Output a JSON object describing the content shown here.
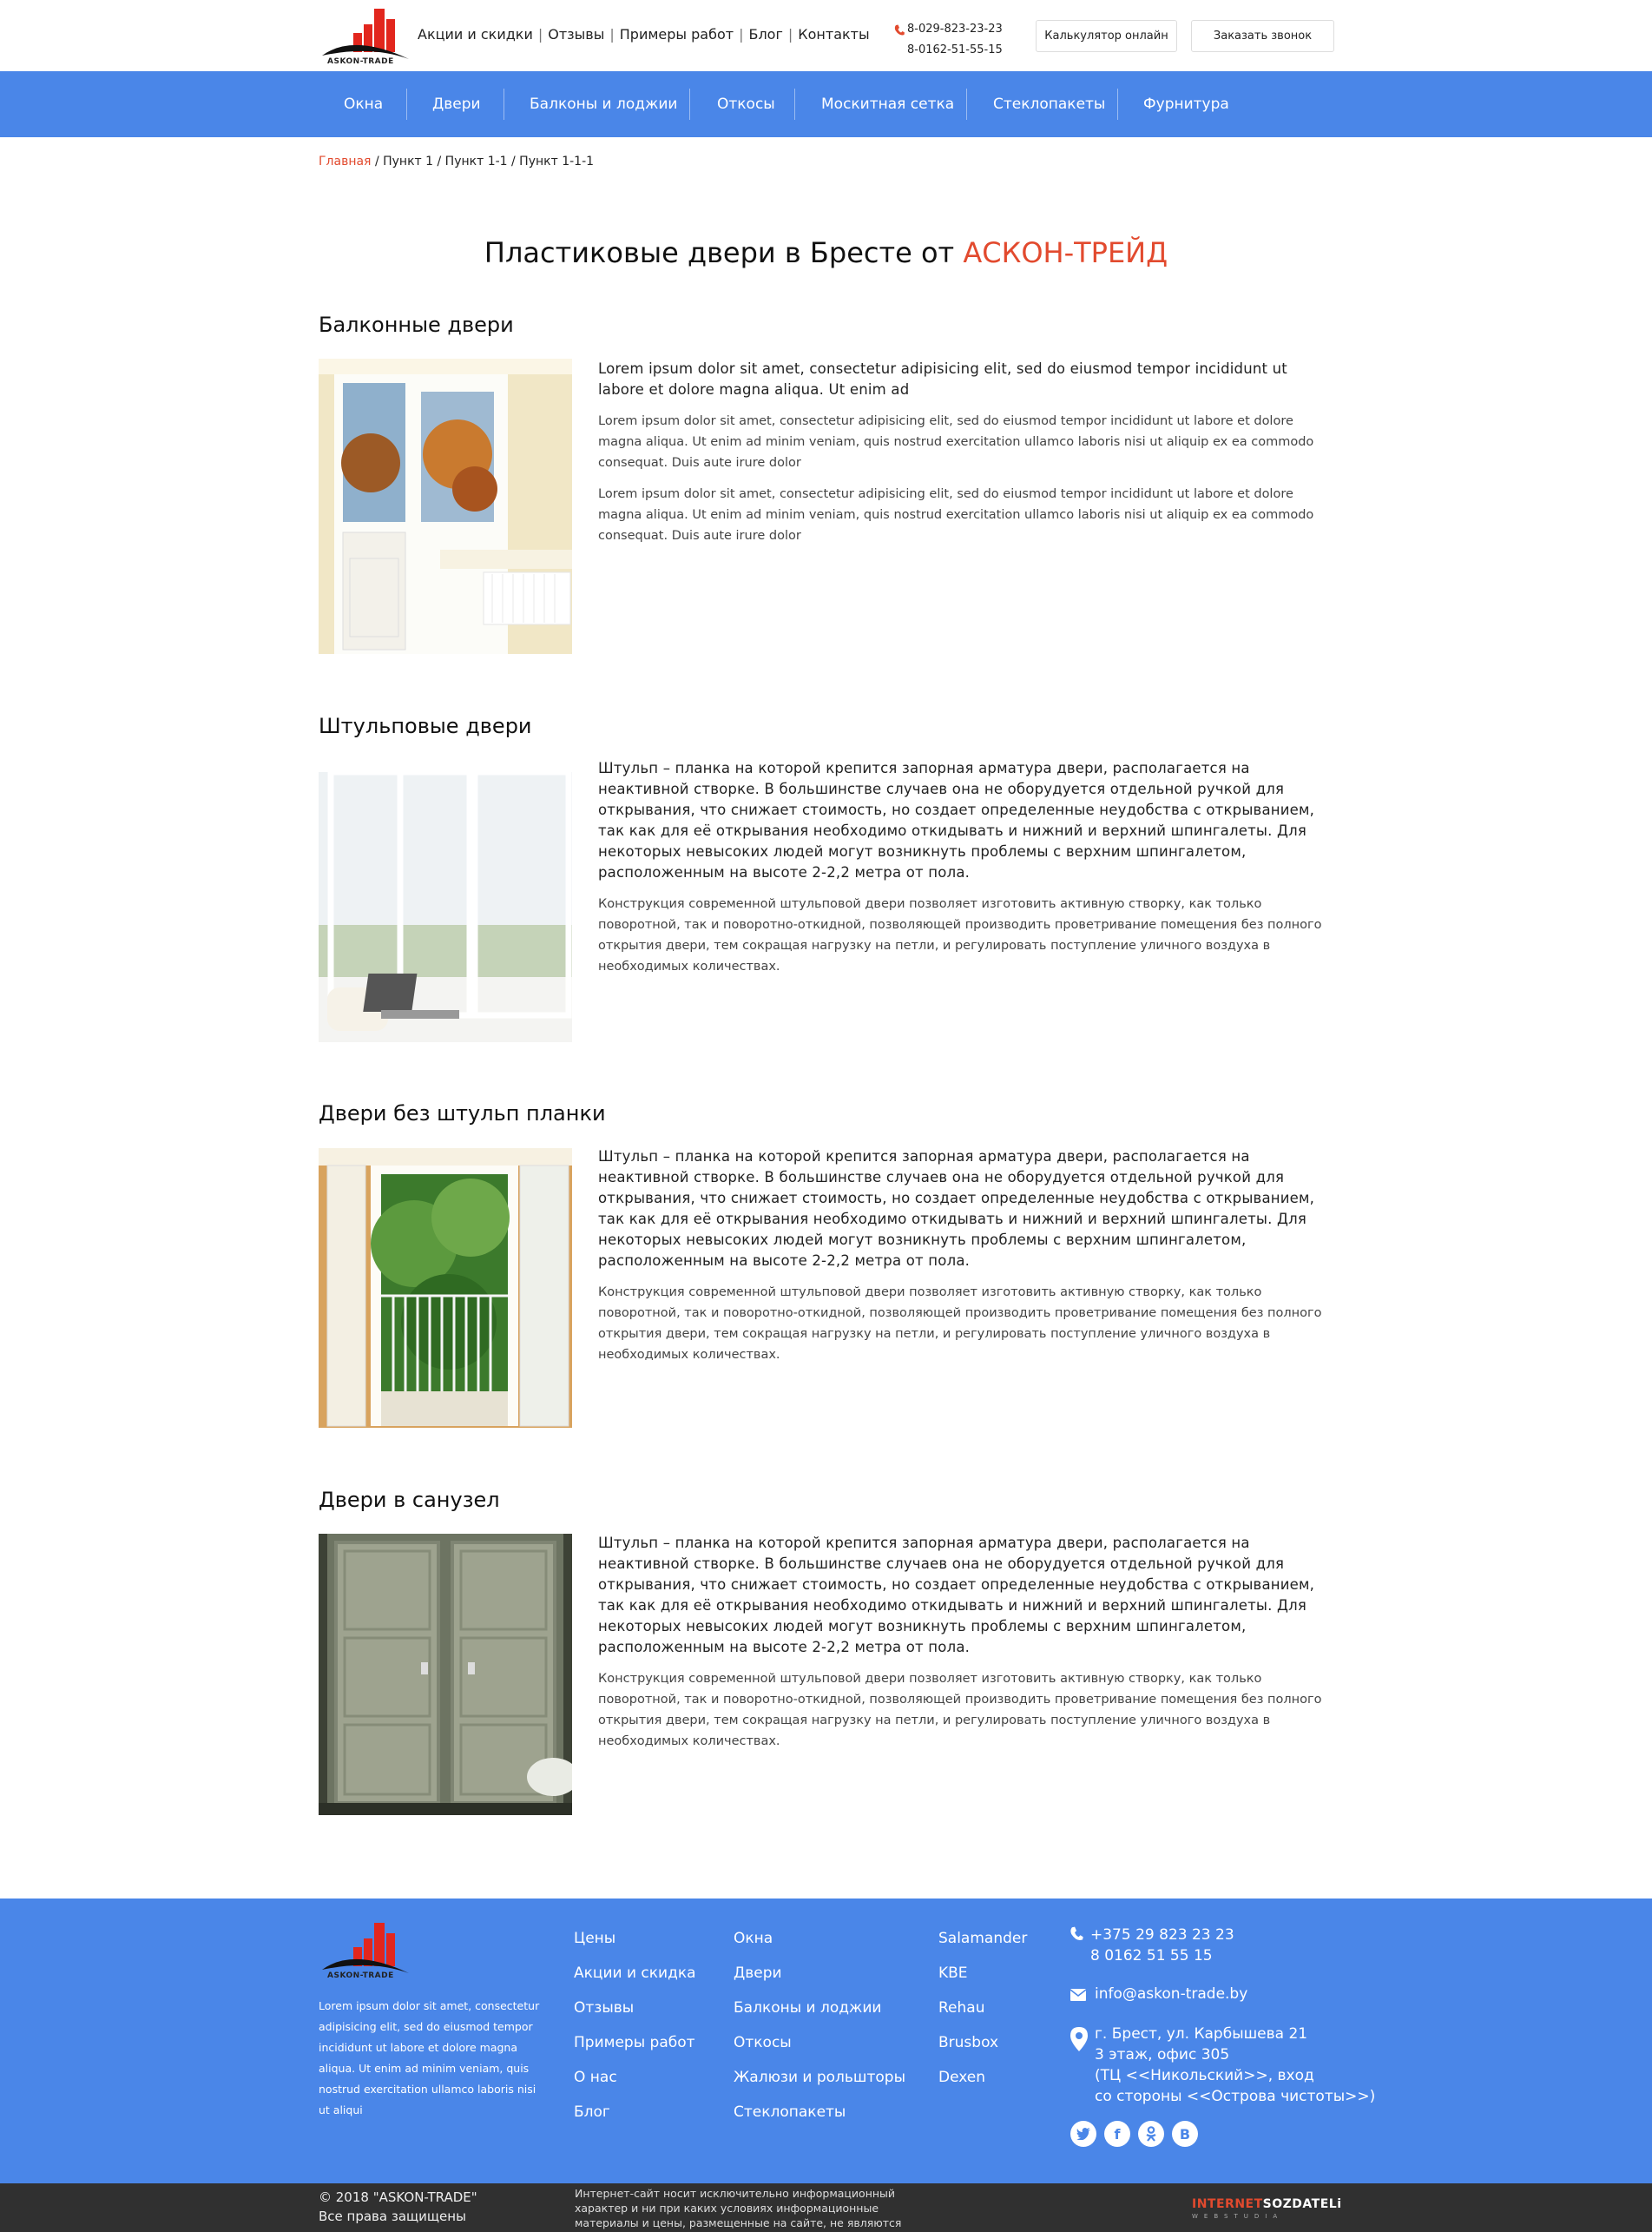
{
  "header": {
    "logo_text": "ASKON-TRADE",
    "menu": [
      "Акции и скидки",
      "Отзывы",
      "Примеры работ",
      "Блог",
      "Контакты"
    ],
    "phones": [
      "8-029-823-23-23",
      "8-0162-51-55-15"
    ],
    "calc_button": "Калькулятор онлайн",
    "call_button": "Заказать звонок"
  },
  "nav": [
    "Окна",
    "Двери",
    "Балконы и лоджии",
    "Откосы",
    "Москитная сетка",
    "Стеклопакеты",
    "Фурнитура"
  ],
  "breadcrumbs": {
    "home": "Главная",
    "items": [
      "/ Пункт 1",
      "/ Пункт 1-1",
      "/ Пункт 1-1-1"
    ]
  },
  "page": {
    "title": "Пластиковые двери в Бресте от",
    "brand": "АСКОН-ТРЕЙД"
  },
  "sections": [
    {
      "title": "Балконные двери",
      "lead": "Lorem ipsum dolor sit amet, consectetur adipisicing elit, sed do eiusmod tempor incididunt ut labore et dolore magna aliqua. Ut enim ad",
      "paras": [
        "Lorem ipsum dolor sit amet, consectetur adipisicing elit, sed do eiusmod tempor incididunt ut labore et dolore magna aliqua. Ut enim ad minim veniam, quis nostrud exercitation ullamco laboris nisi ut aliquip ex ea commodo consequat. Duis aute irure dolor",
        "Lorem ipsum dolor sit amet, consectetur adipisicing elit, sed do eiusmod tempor incididunt ut labore et dolore magna aliqua. Ut enim ad minim veniam, quis nostrud exercitation ullamco laboris nisi ut aliquip ex ea commodo consequat. Duis aute irure dolor"
      ]
    },
    {
      "title": "Штульповые двери",
      "lead": "Штульп – планка на которой крепится запорная арматура двери, располагается на неактивной створке. В большинстве случаев она не оборудуется отдельной ручкой для открывания, что снижает стоимость, но создает определенные неудобства с открыванием, так как для её открывания необходимо откидывать и нижний и верхний шпингалеты. Для некоторых невысоких людей могут возникнуть проблемы с верхним шпингалетом, расположенным на высоте 2-2,2 метра от пола.",
      "paras": [
        "Конструкция современной штульповой двери позволяет изготовить активную створку, как только поворотной, так и поворотно-откидной, позволяющей производить проветривание помещения без полного открытия двери, тем сокращая нагрузку на петли, и регулировать поступление уличного воздуха в необходимых количествах."
      ]
    },
    {
      "title": "Двери без штульп планки",
      "lead": "Штульп – планка на которой крепится запорная арматура двери, располагается на неактивной створке. В большинстве случаев она не оборудуется отдельной ручкой для открывания, что снижает стоимость, но создает определенные неудобства с открыванием, так как для её открывания необходимо откидывать и нижний и верхний шпингалеты. Для некоторых невысоких людей могут возникнуть проблемы с верхним шпингалетом, расположенным на высоте 2-2,2 метра от пола.",
      "paras": [
        "Конструкция современной штульповой двери позволяет изготовить активную створку, как только поворотной, так и поворотно-откидной, позволяющей производить проветривание помещения без полного открытия двери, тем сокращая нагрузку на петли, и регулировать поступление уличного воздуха в необходимых количествах."
      ]
    },
    {
      "title": "Двери в санузел",
      "lead": "Штульп – планка на которой крепится запорная арматура двери, располагается на неактивной створке. В большинстве случаев она не оборудуется отдельной ручкой для открывания, что снижает стоимость, но создает определенные неудобства с открыванием, так как для её открывания необходимо откидывать и нижний и верхний шпингалеты. Для некоторых невысоких людей могут возникнуть проблемы с верхним шпингалетом, расположенным на высоте 2-2,2 метра от пола.",
      "paras": [
        "Конструкция современной штульповой двери позволяет изготовить активную створку, как только поворотной, так и поворотно-откидной, позволяющей производить проветривание помещения без полного открытия двери, тем сокращая нагрузку на петли, и регулировать поступление уличного воздуха в необходимых количествах."
      ]
    }
  ],
  "footer": {
    "logo_text": "ASKON-TRADE",
    "about": "Lorem ipsum dolor sit amet, consectetur adipisicing elit, sed do eiusmod tempor incididunt ut labore et dolore magna aliqua. Ut enim ad minim veniam, quis nostrud exercitation ullamco laboris nisi ut aliqui",
    "col1": [
      "Цены",
      "Акции и скидка",
      "Отзывы",
      "Примеры работ",
      "О нас",
      "Блог"
    ],
    "col2": [
      "Окна",
      "Двери",
      "Балконы и лоджии",
      "Откосы",
      "Жалюзи и рольшторы",
      "Стеклопакеты"
    ],
    "col3": [
      "Salamander",
      "KBE",
      "Rehau",
      "Brusbox",
      "Dexen"
    ],
    "phones": [
      "+375 29 823 23 23",
      "8 0162 51 55 15"
    ],
    "email": "info@askon-trade.by",
    "address": [
      "г. Брест, ул. Карбышева 21",
      "3 этаж, офис 305",
      "(ТЦ <<Никольский>>, вход",
      "со стороны <<Острова чистоты>>)"
    ],
    "social": [
      "twitter-icon",
      "facebook-icon",
      "odnoklassniki-icon",
      "vk-icon"
    ]
  },
  "bottom": {
    "copyright": "© 2018 \"ASKON-TRADE\"",
    "rights": "Все права защищены",
    "disclaimer": "Интернет-сайт носит исключительно информационный характер и ни при каких условиях информационные материалы и цены, размещенные на сайте, не являются публичной офертой.",
    "dev_red": "INTERNET",
    "dev_white": "SOZDATELi",
    "dev_sub": "WEBSTUDIA"
  },
  "colors": {
    "accent_blue": "#4a86e8",
    "brand_red": "#e24a2e",
    "bottom_bar": "#303030"
  }
}
